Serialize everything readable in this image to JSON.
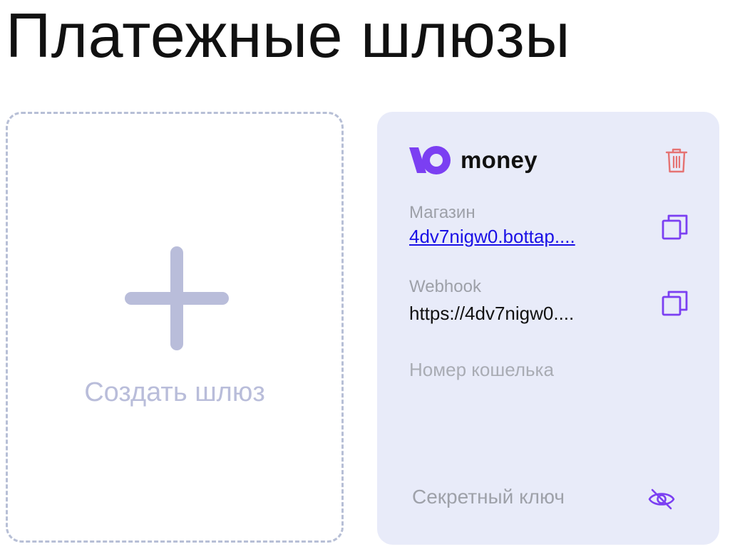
{
  "page": {
    "title": "Платежные шлюзы"
  },
  "create_card": {
    "label": "Создать шлюз",
    "icon": "plus-icon"
  },
  "gateway": {
    "brand": {
      "name": "money",
      "logo_icon": "yoomoney-logo-icon",
      "logo_color": "#7b3ff2"
    },
    "delete_icon": "trash-icon",
    "shop": {
      "label": "Магазин",
      "value": "4dv7nigw0.bottap....",
      "copy_icon": "copy-icon"
    },
    "webhook": {
      "label": "Webhook",
      "value": "https://4dv7nigw0....",
      "copy_icon": "copy-icon"
    },
    "wallet": {
      "label": "Номер кошелька"
    },
    "secret": {
      "label": "Секретный ключ",
      "toggle_icon": "eye-off-icon"
    }
  },
  "colors": {
    "accent": "#7b3ff2",
    "danger": "#e57373",
    "card_bg": "#e8ebf9",
    "dashed_border": "#b7bfd6",
    "plus": "#b9bdda",
    "link": "#1a10e6"
  }
}
